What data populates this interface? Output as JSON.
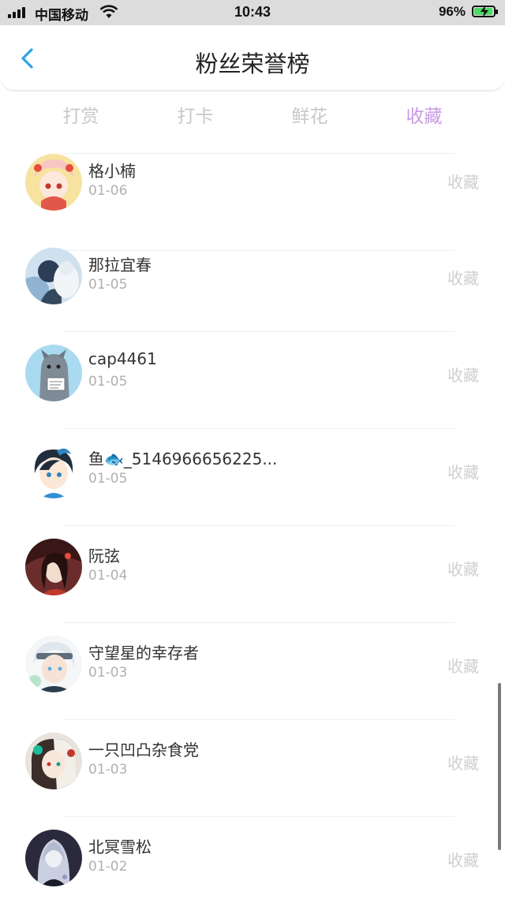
{
  "status_bar": {
    "carrier": "中国移动",
    "time": "10:43",
    "battery_percent": "96%",
    "battery_level": 0.96,
    "icons": [
      "signal-icon",
      "wifi-icon",
      "battery-charging-icon"
    ]
  },
  "header": {
    "back_icon": "chevron-left-icon",
    "title": "粉丝荣誉榜"
  },
  "tabs": [
    {
      "label": "打赏",
      "active": false
    },
    {
      "label": "打卡",
      "active": false
    },
    {
      "label": "鲜花",
      "active": false
    },
    {
      "label": "收藏",
      "active": true
    }
  ],
  "colors": {
    "accent": "#c99be3",
    "back_icon": "#2ea3e6",
    "inactive_tab": "#c8c8c8",
    "muted_text": "#b0b0b0"
  },
  "fans": [
    {
      "name": "格小楠",
      "date": "01-06",
      "action": "收藏"
    },
    {
      "name": "那拉宜春",
      "date": "01-05",
      "action": "收藏"
    },
    {
      "name": "cap4461",
      "date": "01-05",
      "action": "收藏"
    },
    {
      "name": "鱼🐟_5146966656225...",
      "date": "01-05",
      "action": "收藏"
    },
    {
      "name": "阮弦",
      "date": "01-04",
      "action": "收藏"
    },
    {
      "name": "守望星的幸存者",
      "date": "01-03",
      "action": "收藏"
    },
    {
      "name": "一只凹凸杂食党",
      "date": "01-03",
      "action": "收藏"
    },
    {
      "name": "北冥雪松",
      "date": "01-02",
      "action": "收藏"
    }
  ]
}
